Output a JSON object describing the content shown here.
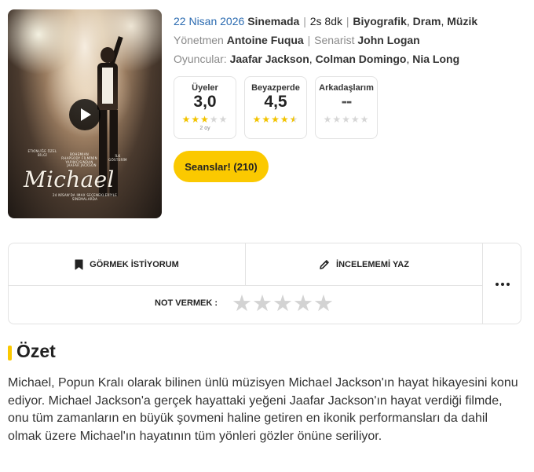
{
  "poster": {
    "small_texts": [
      "ETKİNLİĞE ÖZEL BİLGİ",
      "BOHEMIAN RHAPSODY\nFİLMİNİN YAPIMCISINDAN",
      "İLK GÖSTERİM",
      "JAAFAR JACKSON"
    ],
    "title": "Michael",
    "bottom_text": "24 NİSAN'DA IMAX\nSEÇENEKLERİYLE SİNEMALARDA"
  },
  "meta": {
    "date": "22 Nisan 2026",
    "status": "Sinemada",
    "duration": "2s 8dk",
    "genres": [
      "Biyografik",
      "Dram",
      "Müzik"
    ],
    "director_label": "Yönetmen",
    "director": "Antoine Fuqua",
    "writer_label": "Senarist",
    "writer": "John Logan",
    "cast_label": "Oyuncular:",
    "cast": [
      "Jaafar Jackson",
      "Colman Domingo",
      "Nia Long"
    ]
  },
  "ratings": {
    "users": {
      "label": "Üyeler",
      "value": "3,0",
      "stars": 3,
      "votes": "2 oy"
    },
    "critics": {
      "label": "Beyazperde",
      "value": "4,5",
      "stars": 4.5
    },
    "friends": {
      "label": "Arkadaşlarım",
      "value": "--",
      "stars": 0
    }
  },
  "sessions_button": "Seanslar! (210)",
  "actions": {
    "want_to_see": "GÖRMEK İSTİYORUM",
    "write_review": "İNCELEMEMİ YAZ",
    "vote_label": "NOT VERMEK :",
    "vote_stars": 0
  },
  "summary": {
    "title": "Özet",
    "text": "Michael, Popun Kralı olarak bilinen ünlü müzisyen Michael Jackson'ın hayat hikayesini konu ediyor. Michael Jackson'a gerçek hayattaki yeğeni Jaafar Jackson'ın hayat verdiği filmde, onu tüm zamanların en büyük şovmeni haline getiren en ikonik performansları da dahil olmak üzere Michael'ın hayatının tüm yönleri gözler önüne seriliyor."
  },
  "colors": {
    "accent": "#fbc900",
    "link": "#2a6ab0",
    "star": "#f2c300",
    "star_empty": "#d6d6d6"
  }
}
